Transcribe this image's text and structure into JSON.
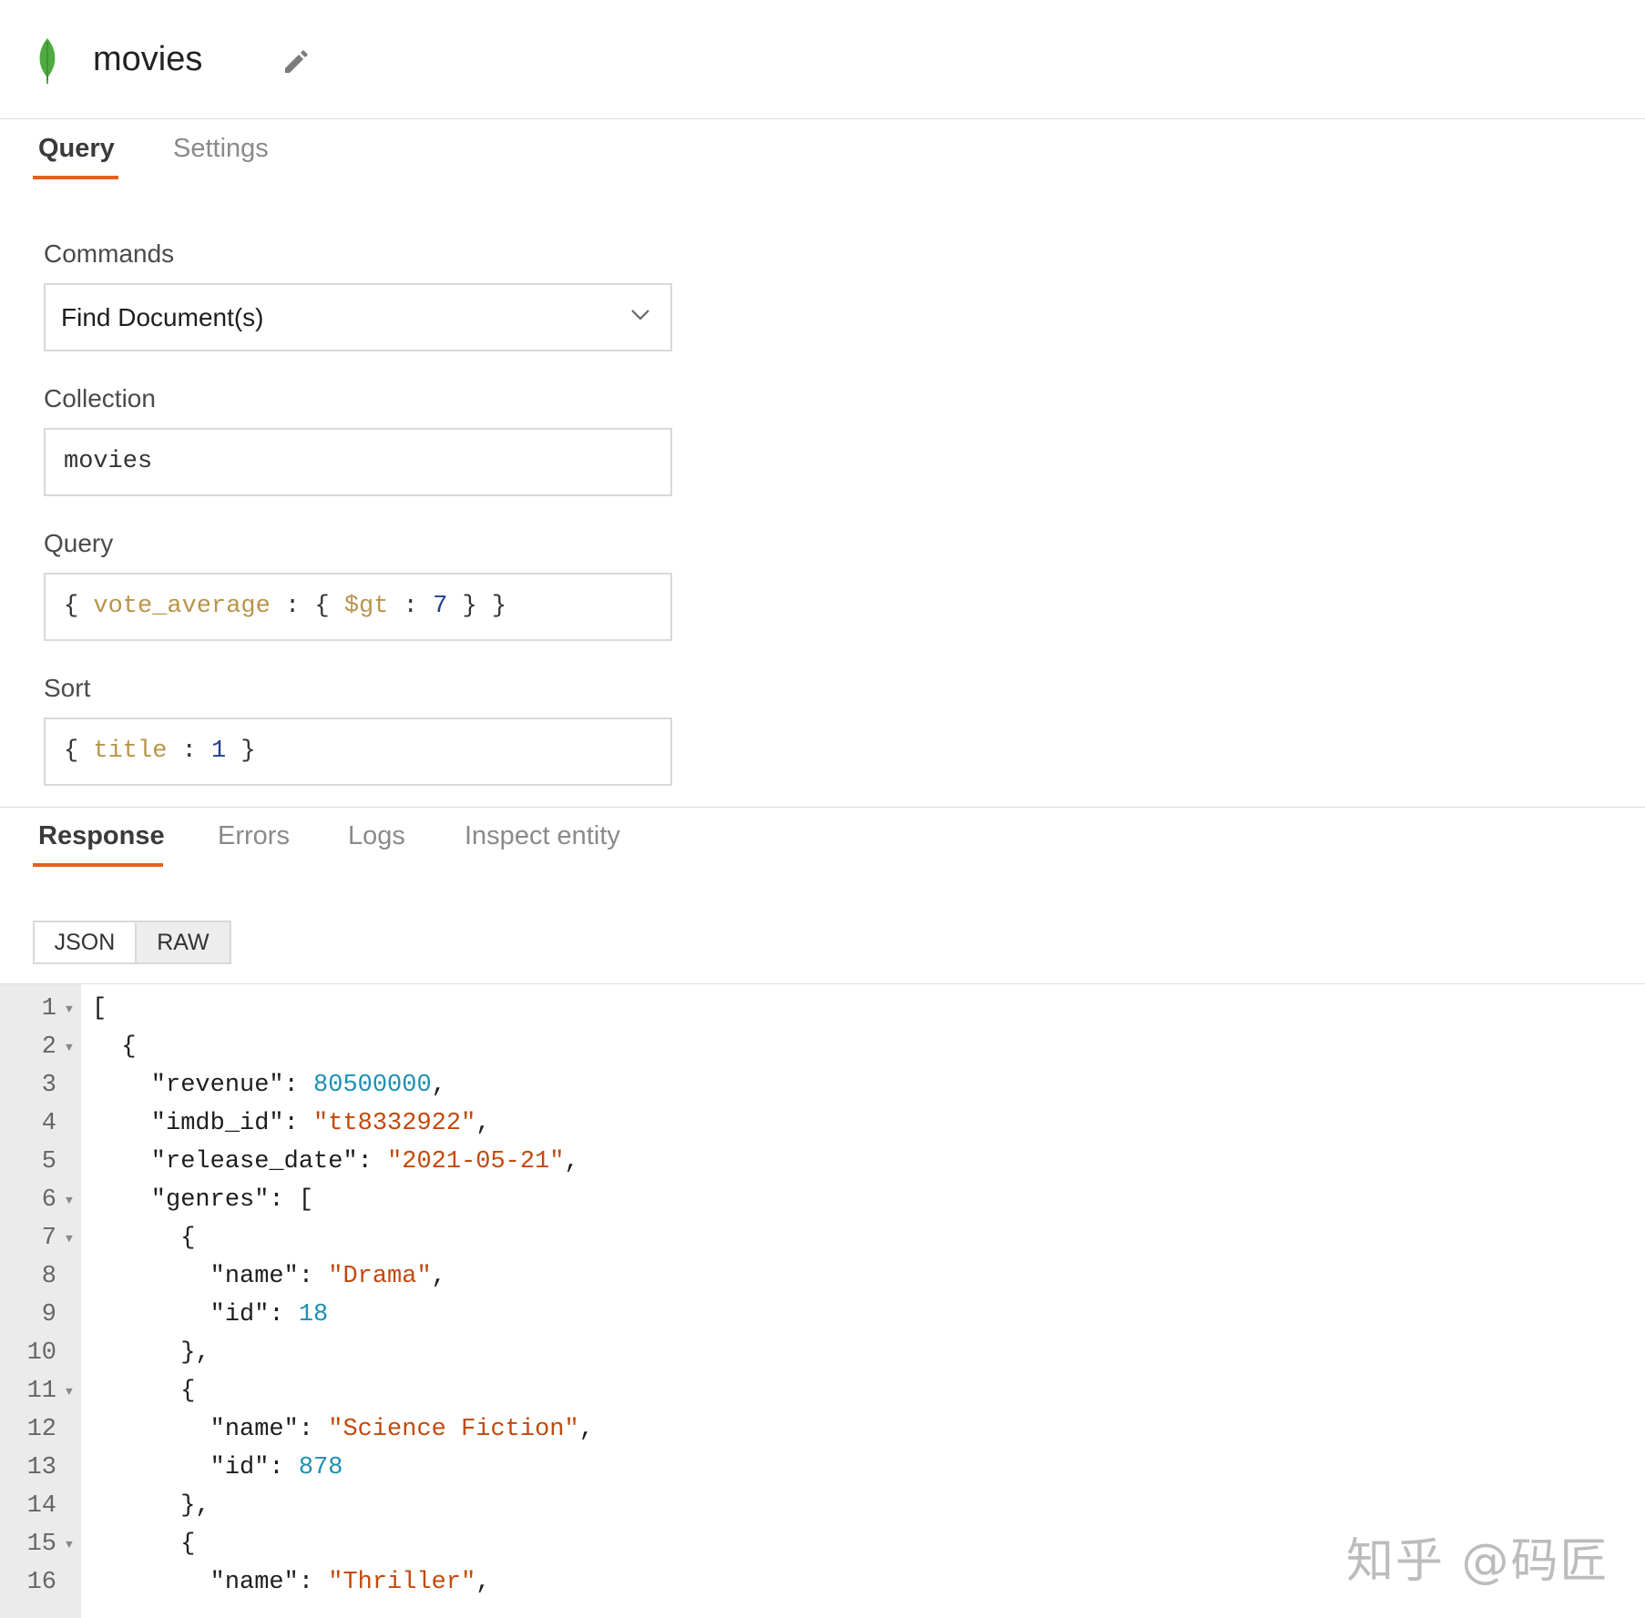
{
  "header": {
    "title": "movies",
    "logo_icon": "mongodb-leaf-icon",
    "edit_icon": "pencil-icon"
  },
  "top_tabs": [
    {
      "label": "Query",
      "active": true
    },
    {
      "label": "Settings",
      "active": false
    }
  ],
  "form": {
    "commands": {
      "label": "Commands",
      "value": "Find Document(s)"
    },
    "collection": {
      "label": "Collection",
      "value": "movies"
    },
    "query": {
      "label": "Query",
      "value": "{ vote_average : { $gt : 7 } }"
    },
    "sort": {
      "label": "Sort",
      "value": "{ title : 1 }"
    }
  },
  "response_tabs": [
    {
      "label": "Response",
      "active": true
    },
    {
      "label": "Errors",
      "active": false
    },
    {
      "label": "Logs",
      "active": false
    },
    {
      "label": "Inspect entity",
      "active": false
    }
  ],
  "view_toggle": {
    "json_label": "JSON",
    "raw_label": "RAW",
    "selected": "JSON"
  },
  "code_lines": [
    {
      "n": "1",
      "fold": true,
      "text": "["
    },
    {
      "n": "2",
      "fold": true,
      "text": "  {"
    },
    {
      "n": "3",
      "fold": false,
      "text": "    \"revenue\": 80500000,"
    },
    {
      "n": "4",
      "fold": false,
      "text": "    \"imdb_id\": \"tt8332922\","
    },
    {
      "n": "5",
      "fold": false,
      "text": "    \"release_date\": \"2021-05-21\","
    },
    {
      "n": "6",
      "fold": true,
      "text": "    \"genres\": ["
    },
    {
      "n": "7",
      "fold": true,
      "text": "      {"
    },
    {
      "n": "8",
      "fold": false,
      "text": "        \"name\": \"Drama\","
    },
    {
      "n": "9",
      "fold": false,
      "text": "        \"id\": 18"
    },
    {
      "n": "10",
      "fold": false,
      "text": "      },"
    },
    {
      "n": "11",
      "fold": true,
      "text": "      {"
    },
    {
      "n": "12",
      "fold": false,
      "text": "        \"name\": \"Science Fiction\","
    },
    {
      "n": "13",
      "fold": false,
      "text": "        \"id\": 878"
    },
    {
      "n": "14",
      "fold": false,
      "text": "      },"
    },
    {
      "n": "15",
      "fold": true,
      "text": "      {"
    },
    {
      "n": "16",
      "fold": false,
      "text": "        \"name\": \"Thriller\","
    }
  ],
  "watermark": "知乎 @码匠",
  "colors": {
    "accent": "#e8611a",
    "string": "#c2490c",
    "number": "#1d8fb3",
    "query_key": "#b8954a",
    "query_number": "#1f3f8f"
  }
}
